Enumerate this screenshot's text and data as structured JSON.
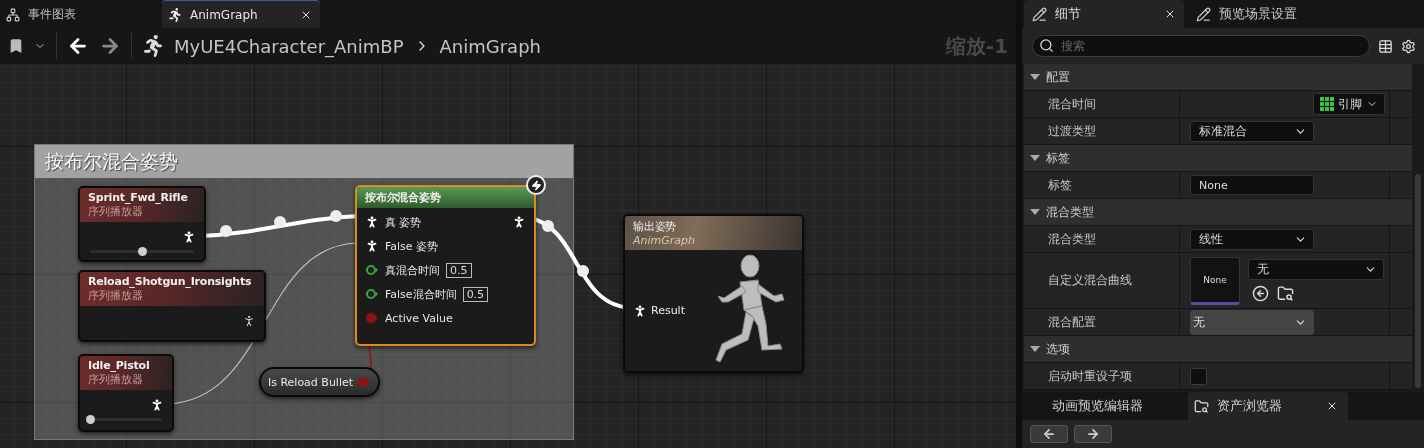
{
  "graph_tabs": [
    {
      "label": "事件图表",
      "selected": false
    },
    {
      "label": "AnimGraph",
      "selected": true
    }
  ],
  "breadcrumb": {
    "path": [
      "MyUE4Character_AnimBP",
      "AnimGraph"
    ],
    "zoom": "缩放-1"
  },
  "comment": {
    "title": "按布尔混合姿势"
  },
  "nodes": [
    {
      "kind": "sequence",
      "title": "Sprint_Fwd_Rifle",
      "subtitle": "序列播放器",
      "connected": true,
      "level": 0.5,
      "selected": false
    },
    {
      "kind": "sequence",
      "title": "Reload_Shotgun_Ironsights",
      "subtitle": "序列播放器",
      "connected": false,
      "selected": false
    },
    {
      "kind": "sequence",
      "title": "Idle_Pistol",
      "subtitle": "序列播放器",
      "connected": true,
      "level": 0,
      "selected": false
    },
    {
      "kind": "blend",
      "title": "按布尔混合姿势",
      "selected": true,
      "pins": [
        {
          "kind": "pose",
          "label": "真 姿势"
        },
        {
          "kind": "pose",
          "label": "False 姿势"
        },
        {
          "kind": "float",
          "label": "真混合时间",
          "value": "0.5"
        },
        {
          "kind": "float",
          "label": "False混合时间",
          "value": "0.5"
        },
        {
          "kind": "bool",
          "label": "Active Value"
        }
      ]
    },
    {
      "kind": "variable",
      "title": "Is Reload Bullet",
      "selected": false
    },
    {
      "kind": "output",
      "title": "输出姿势",
      "subtitle": "AnimGraph",
      "pin": "Result",
      "selected": false
    }
  ],
  "details": {
    "tabs": [
      {
        "label": "细节",
        "selected": true
      },
      {
        "label": "预览场景设置",
        "selected": false
      }
    ],
    "search": {
      "placeholder": "搜索"
    },
    "sections": [
      {
        "title": "配置",
        "expanded": true,
        "rows": [
          {
            "label": "混合时间",
            "kind": "pin-button",
            "value": "引脚"
          },
          {
            "label": "过渡类型",
            "kind": "dropdown",
            "value": "标准混合",
            "hovered": false
          }
        ]
      },
      {
        "title": "标签",
        "expanded": true,
        "rows": [
          {
            "label": "标签",
            "kind": "text",
            "value": "None"
          }
        ]
      },
      {
        "title": "混合类型",
        "expanded": true,
        "rows": [
          {
            "label": "混合类型",
            "kind": "dropdown",
            "value": "线性",
            "hovered": false
          },
          {
            "label": "自定义混合曲线",
            "kind": "asset",
            "thumbnail": "None",
            "value": "无"
          },
          {
            "label": "混合配置",
            "kind": "dropdown",
            "value": "无",
            "hovered": true
          }
        ]
      },
      {
        "title": "选项",
        "expanded": true,
        "rows": [
          {
            "label": "启动时重设子项",
            "kind": "checkbox",
            "checked": false
          }
        ]
      }
    ]
  },
  "bottom_tabs": [
    {
      "label": "动画预览编辑器",
      "selected": false
    },
    {
      "label": "资产浏览器",
      "selected": true
    }
  ]
}
